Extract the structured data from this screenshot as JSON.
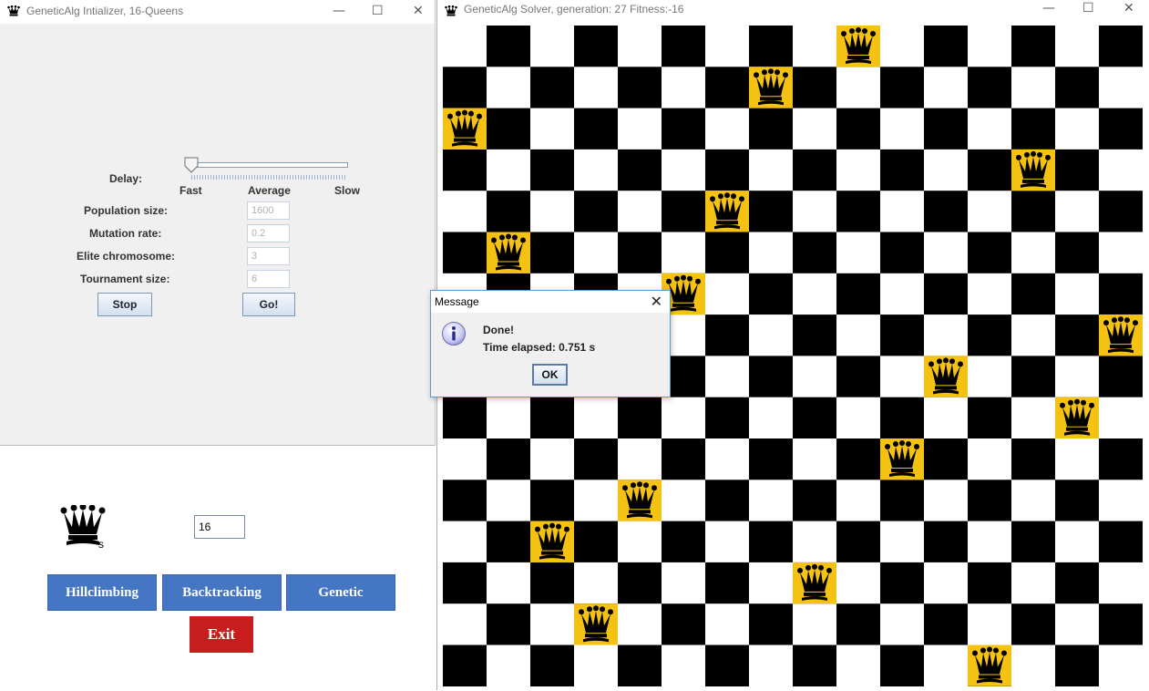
{
  "initializer": {
    "title": "GeneticAlg Intializer, 16-Queens",
    "controls": {
      "minimize": "—",
      "maximize": "☐",
      "close": "✕"
    },
    "delay_label": "Delay:",
    "slider": {
      "value": 0,
      "ticks": [
        "Fast",
        "Average",
        "Slow"
      ]
    },
    "fields": [
      {
        "label": "Population size:",
        "value": "1600"
      },
      {
        "label": "Mutation rate:",
        "value": "0.2"
      },
      {
        "label": "Elite chromosome:",
        "value": "3"
      },
      {
        "label": "Tournament size:",
        "value": "6"
      }
    ],
    "stop_label": "Stop",
    "go_label": "Go!"
  },
  "launcher": {
    "s_letter": "s",
    "n_value": "16",
    "buttons": [
      "Hillclimbing",
      "Backtracking",
      "Genetic"
    ],
    "exit_label": "Exit",
    "colors": {
      "algo_button": "#4476c4",
      "exit_button": "#c81d1d"
    }
  },
  "solver": {
    "title": "GeneticAlg Solver, generation: 27 Fitness:-16",
    "controls": {
      "minimize": "—",
      "maximize": "☐",
      "close": "✕"
    },
    "board_size": 16,
    "queens_by_row": [
      9,
      7,
      0,
      13,
      6,
      1,
      5,
      15,
      11,
      14,
      10,
      4,
      2,
      8,
      3,
      12
    ],
    "colors": {
      "dark": "#000000",
      "light": "#ffffff",
      "queen_cell": "#f5c211"
    }
  },
  "dialog": {
    "title": "Message",
    "close": "✕",
    "line1": "Done!",
    "line2": "Time elapsed: 0.751 s",
    "ok_label": "OK"
  }
}
